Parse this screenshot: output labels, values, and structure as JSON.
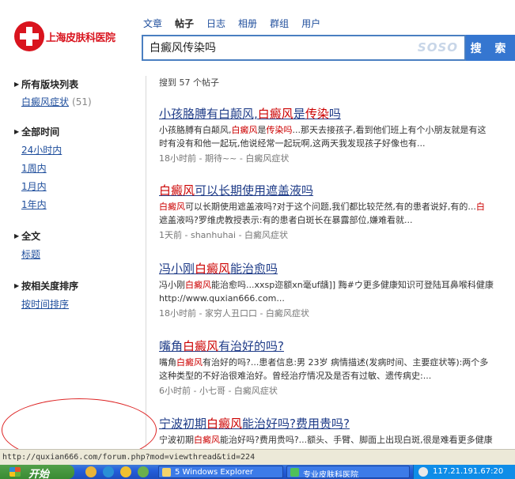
{
  "logo": {
    "text": "上海皮肤科医院"
  },
  "tabs": [
    {
      "label": "文章"
    },
    {
      "label": "帖子"
    },
    {
      "label": "日志"
    },
    {
      "label": "相册"
    },
    {
      "label": "群组"
    },
    {
      "label": "用户"
    }
  ],
  "search": {
    "value": "白癜风传染吗",
    "watermark": "SOSO",
    "button_label": "搜 索"
  },
  "sidebar": {
    "sections": [
      {
        "heading": "所有版块列表",
        "links": [
          {
            "label": "白癜风症状",
            "count": "(51)"
          }
        ]
      },
      {
        "heading": "全部时间",
        "links": [
          {
            "label": "24小时内"
          },
          {
            "label": "1周内"
          },
          {
            "label": "1月内"
          },
          {
            "label": "1年内"
          }
        ]
      },
      {
        "heading": "全文",
        "links": [
          {
            "label": "标题"
          }
        ]
      },
      {
        "heading": "按相关度排序",
        "links": [
          {
            "label": "按时间排序"
          }
        ]
      }
    ]
  },
  "results_summary": "搜到 57 个帖子",
  "results": [
    {
      "title_parts": [
        "小孩胳膊有白颠风,",
        "白癜风",
        "是",
        "传染",
        "吗"
      ],
      "snippet1_parts": [
        "小孩胳膊有白颠风,",
        "白癜风",
        "是",
        "传染吗",
        "...那天去接孩子,看到他们班上有个小朋友就是有这"
      ],
      "snippet2": "时有没有和他一起玩,他说经常一起玩啊,这两天我发现孩子好像也有...",
      "meta": "18小时前 - 期待~~ - 白癜风症状"
    },
    {
      "title_parts": [
        "",
        "白癜风",
        "可以长期使用遮盖液吗"
      ],
      "snippet1_parts": [
        "",
        "白癜风",
        "可以长期使用遮盖液吗?对于这个问题,我们都比较茫然,有的患者说好,有的...",
        "白"
      ],
      "snippet2": "遮盖液吗?罗维虎教授表示:有的患者白斑长在暴露部位,嫌难看就...",
      "meta": "1天前 - shanhuhai - 白癜风症状"
    },
    {
      "title_parts": [
        "冯小刚",
        "白癜风",
        "能治愈吗"
      ],
      "snippet1_parts": [
        "冯小刚",
        "白癜风",
        "能治愈吗...xxsp迩额xn毫uf龋]] 黣#ウ更多健康知识可登陆耳鼻喉科健康"
      ],
      "snippet2": "http://www.quxian666.com...",
      "meta": "18小时前 - 家穷人丑口口 - 白癜风症状"
    },
    {
      "title_parts": [
        "嘴角",
        "白癜风",
        "有治好的吗?"
      ],
      "snippet1_parts": [
        "嘴角",
        "白癜风",
        "有治好的吗?...患者信息:男 23岁 病情描述(发病时间、主要症状等):两个多"
      ],
      "snippet2": "这种类型的不好治很难治好。曾经治疗情况及是否有过敏、遗传病史:...",
      "meta": "6小时前 - 小七哥 - 白癜风症状"
    },
    {
      "title_parts": [
        "宁波初期",
        "白癜风",
        "能治好吗?费用贵吗?"
      ],
      "snippet1_parts": [
        "宁波初期",
        "白癜风",
        "能治好吗?费用贵吗?...额头、手臂、脚面上出现白斑,很是难看更多健康"
      ],
      "snippet2": "",
      "meta": ""
    }
  ],
  "statusbar": {
    "text": "http://quxian666.com/forum.php?mod=viewthread&tid=224"
  },
  "taskbar": {
    "start_label": "开始",
    "tasks": [
      {
        "label": "5 Windows Explorer"
      },
      {
        "label": "专业皮肤科医院"
      }
    ],
    "tray_text": "117.21.191.67:20"
  },
  "colors": {
    "accent": "#3576d0",
    "highlight": "#cc0000",
    "link": "#1f3c88",
    "logo": "#d9141e",
    "annotation": "#dd2222"
  }
}
